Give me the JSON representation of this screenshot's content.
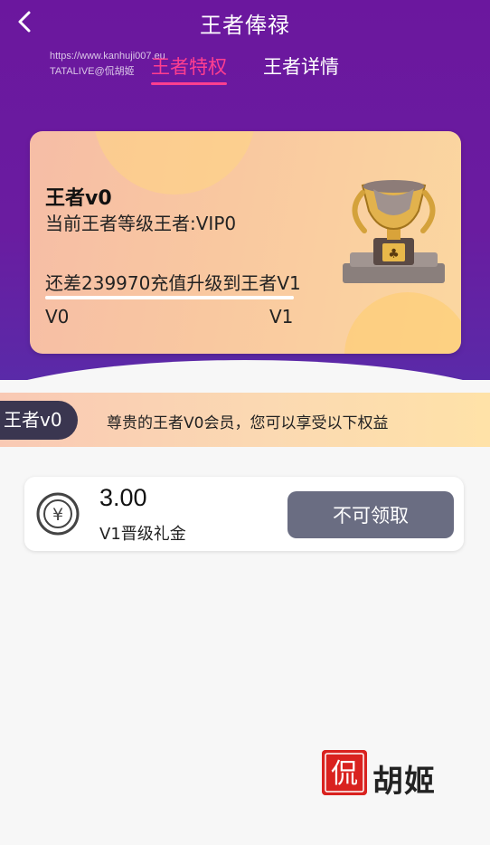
{
  "header": {
    "title": "王者俸禄",
    "watermark_line1": "https://www.kanhuji007.eu",
    "watermark_line2": "TATALIVE@侃胡姬",
    "tabs": [
      {
        "label": "王者特权",
        "active": true
      },
      {
        "label": "王者详情",
        "active": false
      }
    ]
  },
  "level_card": {
    "level_name": "王者v0",
    "level_desc": "当前王者等级王者:VIP0",
    "progress_text": "还差239970充值升级到王者V1",
    "progress_fraction": 0.0,
    "from_level": "V0",
    "to_level": "V1",
    "icon": "trophy-icon"
  },
  "banner": {
    "badge": "王者v0",
    "text": "尊贵的王者V0会员，您可以享受以下权益"
  },
  "rewards": [
    {
      "icon": "yuan-coin-icon",
      "amount": "3.00",
      "name": "V1晋级礼金",
      "button_label": "不可领取"
    }
  ],
  "brand": {
    "seal_text": "侃",
    "name": "胡姬"
  },
  "colors": {
    "header_purple": "#6b179e",
    "active_tab_pink": "#ff3e8f",
    "button_gray": "#6a6d82",
    "badge_dark": "#3a3650",
    "seal_red": "#d9221f"
  }
}
